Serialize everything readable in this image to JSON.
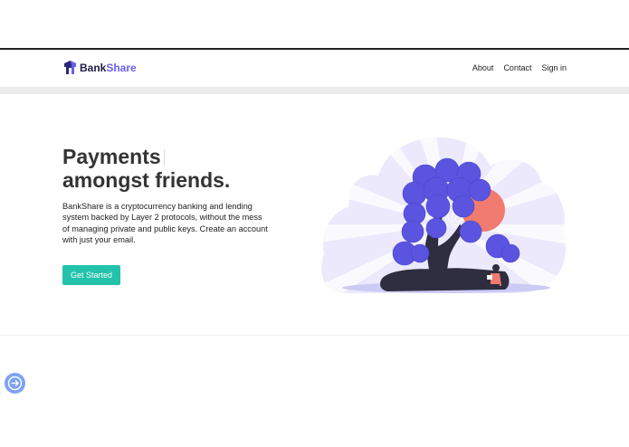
{
  "brand": {
    "name_prefix": "Bank",
    "name_suffix": "Share",
    "accent_color": "#6a5ef2",
    "text_color": "#1f1c4a"
  },
  "nav": {
    "links": [
      {
        "label": "About"
      },
      {
        "label": "Contact"
      },
      {
        "label": "Sign in"
      }
    ]
  },
  "hero": {
    "title_line1": "Payments",
    "title_line2": "amongst friends.",
    "description": "BankShare is a cryptocurrency banking and lending system backed by Layer 2 protocols, without the mess of managing private and public keys. Create an account with just your email.",
    "cta_label": "Get Started",
    "cta_color": "#22c3aa"
  },
  "illustration": {
    "name": "person-reading-under-tree",
    "tree_color": "#5a54e0",
    "sun_color": "#f07b6e",
    "trunk_color": "#2f2e41"
  },
  "floating_action": {
    "icon": "arrow-right-circle-icon",
    "color": "#7ea2f5"
  }
}
